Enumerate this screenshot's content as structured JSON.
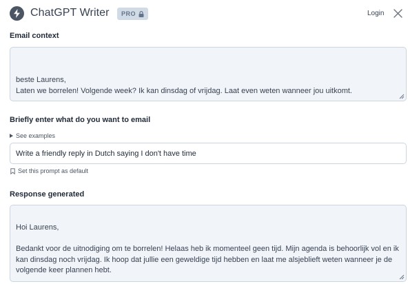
{
  "header": {
    "logo_icon": "lightning-bolt-icon",
    "title": "ChatGPT Writer",
    "badge": "PRO",
    "badge_icon": "lock-icon",
    "login_label": "Login",
    "close_icon": "close-icon"
  },
  "email_context": {
    "label": "Email context",
    "value": "beste Laurens,\nLaten we borrelen! Volgende week? Ik kan dinsdag of vrijdag. Laat even weten wanneer jou uitkomt.\n\ngroetjes!"
  },
  "prompt": {
    "label": "Briefly enter what do you want to email",
    "examples_label": "See examples",
    "value": "Write a friendly reply in Dutch saying I don't have time",
    "set_default_label": "Set this prompt as default",
    "set_default_icon": "bookmark-icon"
  },
  "response": {
    "label": "Response generated",
    "value": "Hoi Laurens,\n\nBedankt voor de uitnodiging om te borrelen! Helaas heb ik momenteel geen tijd. Mijn agenda is behoorlijk vol en ik kan dinsdag noch vrijdag. Ik hoop dat jullie een geweldige tijd hebben en laat me alsjeblieft weten wanneer je de volgende keer plannen hebt.\n\nGroetjes!"
  },
  "colors": {
    "background": "#ffffff",
    "field_background": "#f1f5f9",
    "border": "#cbd5e1",
    "badge_background": "#d1dbe6"
  }
}
